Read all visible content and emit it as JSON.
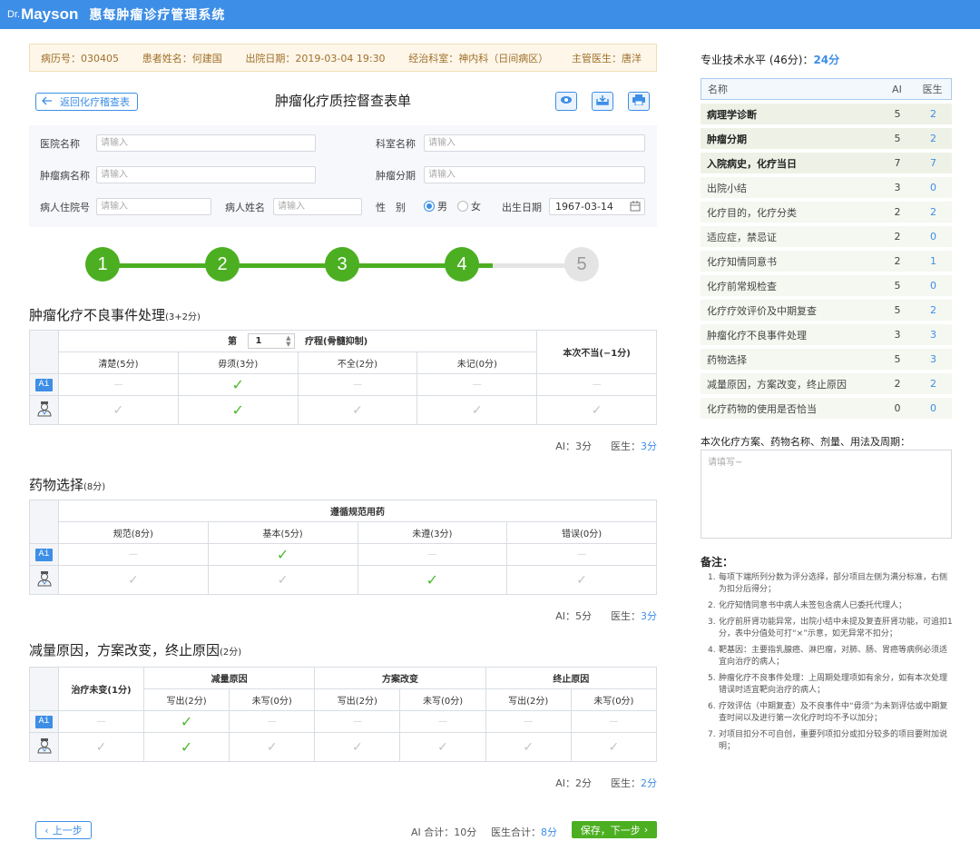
{
  "app": {
    "brand_prefix": "Dr.",
    "brand": "Mayson",
    "system_name": "惠每肿瘤诊疗管理系统"
  },
  "patient": {
    "record_no": "病历号：030405",
    "name": "患者姓名：何建国",
    "discharge": "出院日期：2019-03-04 19:30",
    "department": "经治科室：神内科（日间病区）",
    "doctor": "主管医生：唐洋"
  },
  "form": {
    "back_label": "返回化疗稽查表",
    "title": "肿瘤化疗质控督查表单",
    "fields": {
      "hospital_label": "医院名称",
      "hospital_ph": "请输入",
      "dept_label": "科室名称",
      "dept_ph": "请输入",
      "disease_label": "肿瘤病名称",
      "disease_ph": "请输入",
      "stage_label": "肿瘤分期",
      "stage_ph": "请输入",
      "inpatient_label": "病人住院号",
      "inpatient_ph": "请输入",
      "pname_label": "病人姓名",
      "pname_ph": "请输入",
      "gender_label": "性　别",
      "male": "男",
      "female": "女",
      "dob_label": "出生日期",
      "dob": "1967-03-14"
    }
  },
  "steps": {
    "items": [
      "1",
      "2",
      "3",
      "4",
      "5"
    ],
    "current": 4,
    "progress_fraction": 0.825
  },
  "colors": {
    "primary": "#3d8ee6",
    "success": "#4caf22",
    "step_done": "#4caf22",
    "step_todo": "#e4e4e4"
  },
  "sec1": {
    "title": "肿瘤化疗不良事件处理",
    "points": "(3+2分)",
    "cycle_prefix": "第",
    "cycle_value": "1",
    "cycle_suffix": "疗程(骨髓抑制)",
    "not_proper": "本次不当(−1分)",
    "cols": [
      "清楚(5分)",
      "毋须(3分)",
      "不全(2分)",
      "未记(0分)"
    ],
    "ai_label": "AI：",
    "ai_score": "3分",
    "doc_label": "医生：",
    "doc_score": "3分"
  },
  "sec2": {
    "title": "药物选择",
    "points": "(8分)",
    "group": "遵循规范用药",
    "cols": [
      "规范(8分)",
      "基本(5分)",
      "未遵(3分)",
      "错误(0分)"
    ],
    "ai_label": "AI：",
    "ai_score": "5分",
    "doc_label": "医生：",
    "doc_score": "3分"
  },
  "sec3": {
    "title": "减量原因，方案改变，终止原因",
    "points": "(2分)",
    "col_first": "治疗未变(1分)",
    "groups": [
      "减量原因",
      "方案改变",
      "终止原因"
    ],
    "sub": [
      "写出(2分)",
      "未写(0分)"
    ],
    "ai_label": "AI：",
    "ai_score": "2分",
    "doc_label": "医生：",
    "doc_score": "2分"
  },
  "ai_tag": "Ai",
  "footer": {
    "prev": "上一步",
    "ai_total_label": "AI 合计：",
    "ai_total": "10分",
    "doc_total_label": "医生合计：",
    "doc_total": "8分",
    "save": "保存，下一步"
  },
  "panel": {
    "title": "专业技术水平 (46分)：",
    "score": "24分",
    "head": {
      "name": "名称",
      "ai": "AI",
      "doc": "医生"
    },
    "rows": [
      {
        "name": "病理学诊断",
        "ai": "5",
        "doc": "2"
      },
      {
        "name": "肿瘤分期",
        "ai": "5",
        "doc": "2"
      },
      {
        "name": "入院病史，化疗当日",
        "ai": "7",
        "doc": "7"
      },
      {
        "name": "出院小结",
        "ai": "3",
        "doc": "0"
      },
      {
        "name": "化疗目的，化疗分类",
        "ai": "2",
        "doc": "2"
      },
      {
        "name": "适应症，禁忌证",
        "ai": "2",
        "doc": "0"
      },
      {
        "name": "化疗知情同意书",
        "ai": "2",
        "doc": "1"
      },
      {
        "name": "化疗前常规检查",
        "ai": "5",
        "doc": "0"
      },
      {
        "name": "化疗疗效评价及中期复查",
        "ai": "5",
        "doc": "2"
      },
      {
        "name": "肿瘤化疗不良事件处理",
        "ai": "3",
        "doc": "3"
      },
      {
        "name": "药物选择",
        "ai": "5",
        "doc": "3"
      },
      {
        "name": "减量原因，方案改变，终止原因",
        "ai": "2",
        "doc": "2"
      },
      {
        "name": "化疗药物的使用是否恰当",
        "ai": "0",
        "doc": "0"
      }
    ],
    "plan_label": "本次化疗方案、药物名称、剂量、用法及周期：",
    "plan_ph": "请填写~",
    "notes_title": "备注：",
    "notes": [
      "每项下端所列分数为评分选择，部分项目左侧为满分标准，右侧为扣分后得分；",
      "化疗知情同意书中病人未签包含病人已委托代理人；",
      "化疗前肝肾功能异常，出院小结中未提及复查肝肾功能，可追扣1分，表中分值处可打“×”示意，如无异常不扣分；",
      "靶基因：主要指乳腺癌、淋巴瘤，对肺、肠、胃癌等病例必须适宜向治疗的病人；",
      "肿瘤化疗不良事件处理：上周期处理项如有余分，如有本次处理错误时适宜靶向治疗的病人；",
      "疗效评估（中期复查）及不良事件中“毋须”为未到评估或中期复查时间以及进行第一次化疗时均不予以加分；",
      "对项目扣分不可自创，重要列项扣分或扣分较多的项目要附加说明；"
    ]
  }
}
